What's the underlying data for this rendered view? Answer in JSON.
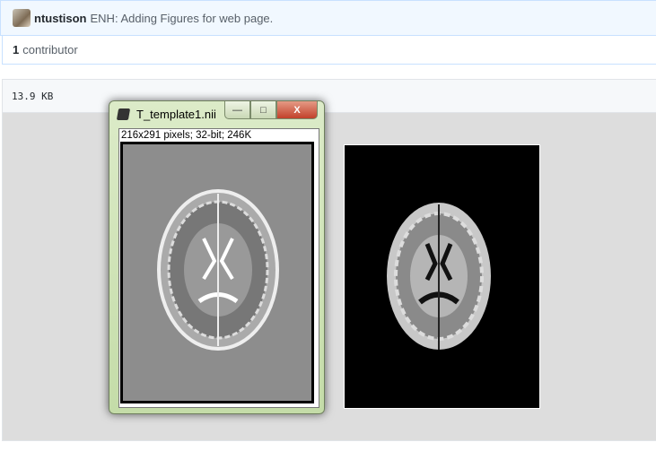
{
  "commit": {
    "author": "ntustison",
    "message": "ENH: Adding Figures for web page."
  },
  "contributors": {
    "count": "1",
    "label": "contributor"
  },
  "file": {
    "size": "13.9 KB"
  },
  "imagej_window": {
    "title": "T_template1.nii",
    "info": "216x291 pixels; 32-bit; 246K",
    "minimize": "—",
    "maximize": "□",
    "close": "X"
  }
}
